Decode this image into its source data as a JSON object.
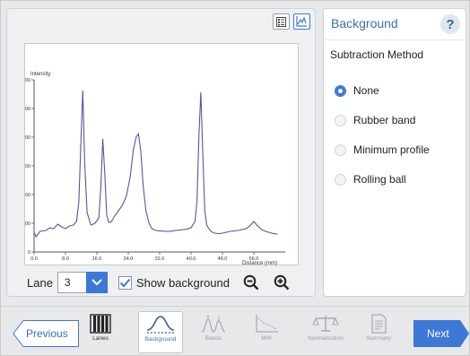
{
  "panel": {
    "title": "Background",
    "help": "?",
    "subtraction_label": "Subtraction Method",
    "options": [
      {
        "label": "None",
        "selected": true
      },
      {
        "label": "Rubber band",
        "selected": false
      },
      {
        "label": "Minimum profile",
        "selected": false
      },
      {
        "label": "Rolling ball",
        "selected": false
      }
    ]
  },
  "controls": {
    "lane_label": "Lane",
    "lane_value": "3",
    "show_background_label": "Show background",
    "show_background_checked": true
  },
  "nav": {
    "previous": "Previous",
    "next": "Next",
    "steps": [
      {
        "label": "Lanes",
        "state": "done"
      },
      {
        "label": "Background",
        "state": "active"
      },
      {
        "label": "Bands",
        "state": "disabled"
      },
      {
        "label": "MW",
        "state": "disabled"
      },
      {
        "label": "Normalization",
        "state": "disabled"
      },
      {
        "label": "Summary",
        "state": "disabled"
      }
    ]
  },
  "colors": {
    "accent": "#3b78d8",
    "profile_line": "#5a53a3"
  },
  "chart_data": {
    "type": "line",
    "xlabel": "Distance (mm)",
    "ylabel": "Intensity",
    "xlim": [
      0,
      64
    ],
    "ylim": [
      0,
      9600
    ],
    "xticks": [
      "0.0",
      "8.0",
      "16.0",
      "24.0",
      "32.0",
      "40.0",
      "48.0",
      "56.0"
    ],
    "yticks": [
      "0",
      "1600",
      "3200",
      "4800",
      "6400",
      "8000",
      "9600"
    ],
    "series": [
      {
        "x": [
          0,
          0.5,
          1.5,
          3,
          4,
          5,
          6,
          7,
          8,
          9,
          10,
          10.8,
          11.4,
          11.9,
          12.4,
          12.9,
          13.5,
          14.5,
          15.5,
          16.5,
          17,
          17.5,
          18,
          18.5,
          19,
          19.5,
          20,
          20.5,
          21.5,
          22.5,
          23.5,
          24.5,
          25.3,
          26,
          26.6,
          27.2,
          27.8,
          28.5,
          29.3,
          30,
          31,
          32,
          33,
          34,
          35,
          36,
          37,
          38,
          39,
          40,
          41,
          41.5,
          42,
          42.5,
          43,
          43.5,
          44,
          45,
          46,
          47,
          48,
          49,
          50,
          51,
          52,
          53,
          54,
          55,
          56,
          57,
          58,
          59,
          60,
          61,
          62
        ],
        "y": [
          1100,
          850,
          1150,
          1200,
          1350,
          1300,
          1550,
          1400,
          1300,
          1450,
          1500,
          1700,
          2800,
          6000,
          9000,
          5000,
          2200,
          1500,
          1600,
          1900,
          3600,
          6300,
          4400,
          2100,
          1650,
          1650,
          1800,
          2000,
          2300,
          2600,
          3100,
          4200,
          5700,
          6400,
          6600,
          5600,
          3700,
          2300,
          1600,
          1300,
          1200,
          1180,
          1160,
          1150,
          1160,
          1200,
          1220,
          1250,
          1280,
          1350,
          1700,
          2800,
          6500,
          8900,
          5500,
          2300,
          1500,
          1150,
          1050,
          1020,
          1050,
          1100,
          1150,
          1180,
          1200,
          1250,
          1300,
          1450,
          1700,
          1450,
          1250,
          1150,
          1080,
          1030,
          1000
        ]
      }
    ]
  }
}
